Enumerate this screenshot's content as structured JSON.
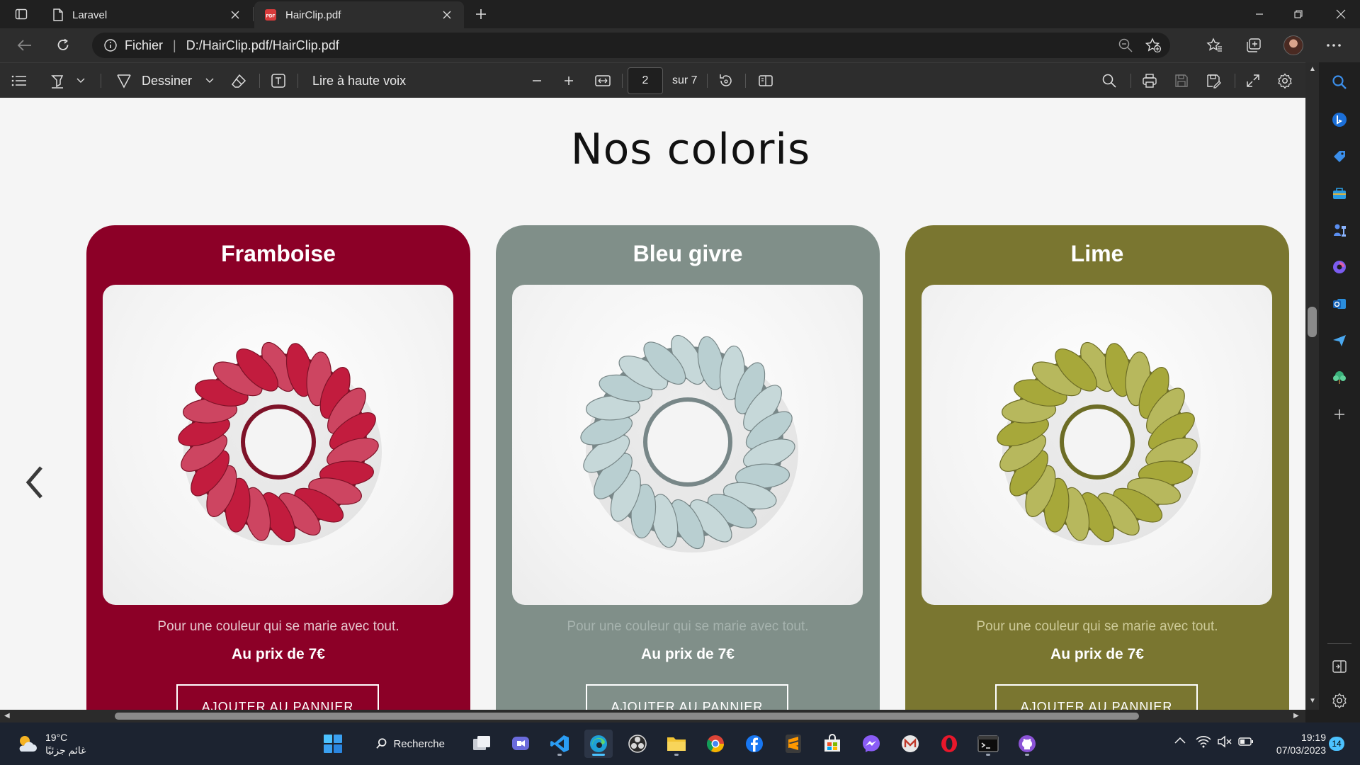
{
  "browser": {
    "tabs": [
      {
        "title": "Laravel",
        "icon": "page-icon",
        "active": false
      },
      {
        "title": "HairClip.pdf",
        "icon": "pdf-icon",
        "active": true
      }
    ],
    "address": {
      "site_label": "Fichier",
      "url": "D:/HairClip.pdf/HairClip.pdf"
    }
  },
  "pdf_toolbar": {
    "draw_label": "Dessiner",
    "read_aloud_label": "Lire à haute voix",
    "current_page": "2",
    "page_total": "sur 7"
  },
  "document": {
    "title": "Nos coloris",
    "cards": [
      {
        "name": "Framboise",
        "color": "#8c0027",
        "desc_color": "#e6c7ce",
        "product_color": "#c21c3e",
        "description": "Pour une couleur qui se marie avec tout.",
        "price": "Au prix de 7€",
        "button": "AJOUTER AU PANNIER"
      },
      {
        "name": "Bleu givre",
        "color": "#808f89",
        "desc_color": "#a6b3ae",
        "product_color": "#b9cfd1",
        "description": "Pour une couleur qui se marie avec tout.",
        "price": "Au prix de 7€",
        "button": "AJOUTER AU PANNIER"
      },
      {
        "name": "Lime",
        "color": "#7a7630",
        "desc_color": "#cdca98",
        "product_color": "#a7a83a",
        "description": "Pour une couleur qui se marie avec tout.",
        "price": "Au prix de 7€",
        "button": "AJOUTER AU PANNIER"
      }
    ]
  },
  "taskbar": {
    "weather_temp": "19°C",
    "weather_desc": "غائم جزئيًا",
    "search_label": "Recherche",
    "time": "19:19",
    "date": "07/03/2023",
    "notifications": "14"
  },
  "colors": {
    "accent": "#4cc2ff",
    "page_bg": "#f5f5f5"
  }
}
